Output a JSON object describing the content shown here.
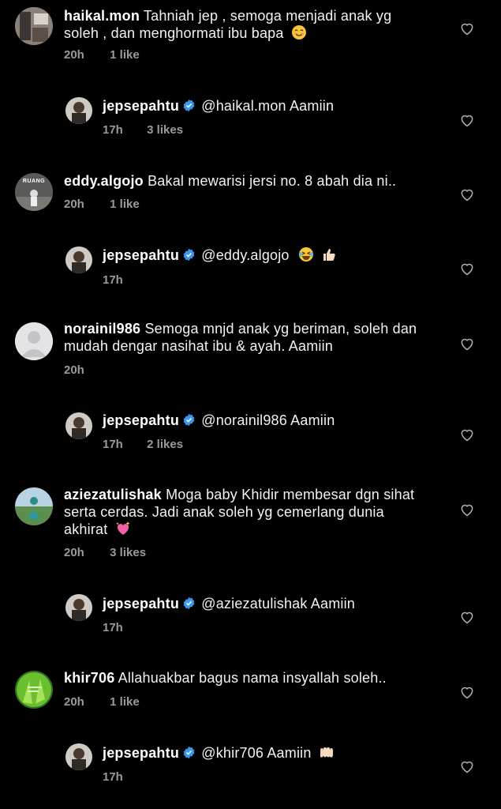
{
  "colors": {
    "background": "#000000",
    "text": "#ffffff",
    "meta": "#9a9a9a",
    "verified": "#3897f0"
  },
  "comments": [
    {
      "username": "haikal.mon",
      "text": "Tahniah jep , semoga menjadi anak yg soleh , dan menghormati ibu bapa",
      "emoji": "smiling-face-emoji",
      "time": "20h",
      "likes": "1 like"
    },
    {
      "username": "jepsepahtu",
      "text": "@haikal.mon Aamiin",
      "time": "17h",
      "likes": "3 likes"
    },
    {
      "username": "eddy.algojo",
      "text": "Bakal mewarisi jersi no. 8 abah dia ni..",
      "avatar_text": "RUANG",
      "time": "20h",
      "likes": "1 like"
    },
    {
      "username": "jepsepahtu",
      "text": "@eddy.algojo",
      "emoji": "laughing-thumbs-up-emoji",
      "time": "17h",
      "likes": ""
    },
    {
      "username": "norainil986",
      "text": "Semoga mnjd anak yg beriman, soleh dan mudah dengar nasihat ibu & ayah. Aamiin",
      "time": "20h",
      "likes": ""
    },
    {
      "username": "jepsepahtu",
      "text": "@norainil986 Aamiin",
      "time": "17h",
      "likes": "2 likes"
    },
    {
      "username": "aziezatulishak",
      "text": "Moga baby Khidir membesar dgn sihat serta cerdas. Jadi anak soleh yg cemerlang dunia akhirat",
      "emoji": "sparkling-heart-emoji",
      "time": "20h",
      "likes": "3 likes"
    },
    {
      "username": "jepsepahtu",
      "text": "@aziezatulishak Aamiin",
      "time": "17h",
      "likes": ""
    },
    {
      "username": "khir706",
      "text": "Allahuakbar bagus nama insyallah soleh..",
      "time": "20h",
      "likes": "1 like"
    },
    {
      "username": "jepsepahtu",
      "text": "@khir706 Aamiin",
      "emoji": "open-hands-emoji",
      "time": "17h",
      "likes": ""
    }
  ]
}
